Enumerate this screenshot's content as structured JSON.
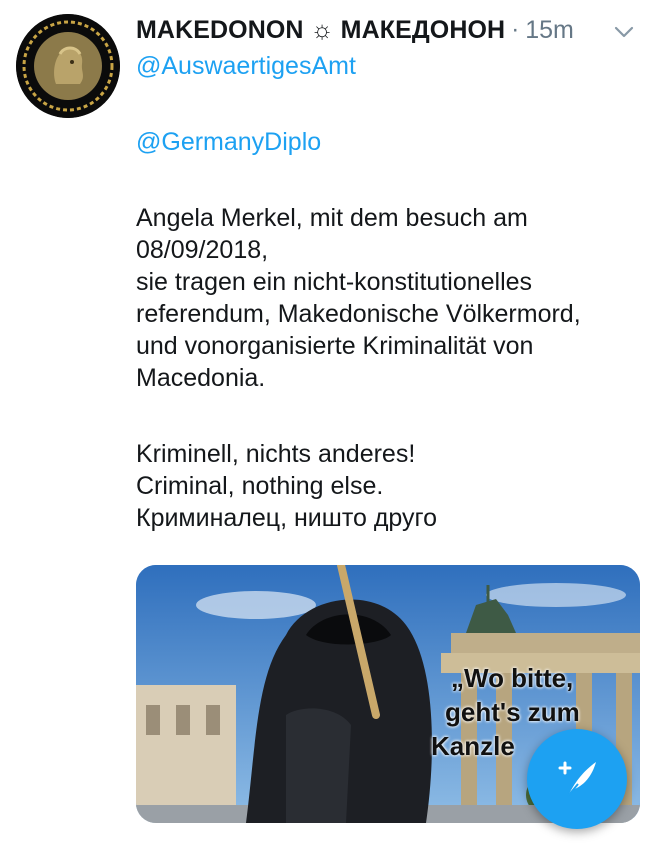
{
  "tweet": {
    "display_name": "MAKEDONON ☼ МАКЕДОНОН",
    "separator": "·",
    "timestamp": "15m",
    "mentions": [
      "@AuswaertigesAmt",
      "@GermanyDiplo"
    ],
    "paragraph1": [
      "Angela Merkel, mit dem besuch am",
      "08/09/2018,",
      "sie tragen ein nicht-konstitutionelles",
      "referendum, Makedonische Völkermord,",
      "und vonorganisierte Kriminalität von",
      "Macedonia."
    ],
    "paragraph2": [
      "Kriminell, nichts anderes!",
      "Criminal, nothing else.",
      "Криминалец, ништо друго"
    ],
    "image_caption_lines": [
      "„Wo bitte,",
      "geht's zum",
      "Kanzle"
    ]
  },
  "icons": {
    "caret": "chevron-down-icon",
    "compose": "compose-tweet-icon"
  },
  "colors": {
    "link": "#1da1f2",
    "muted": "#657786",
    "fab": "#1da1f2"
  }
}
